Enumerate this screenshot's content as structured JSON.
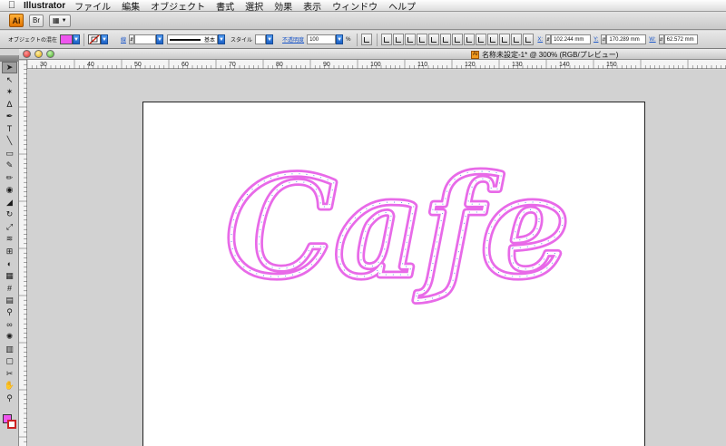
{
  "menubar": {
    "apple": "",
    "app_name": "Illustrator",
    "items": [
      "ファイル",
      "編集",
      "オブジェクト",
      "書式",
      "選択",
      "効果",
      "表示",
      "ウィンドウ",
      "ヘルプ"
    ]
  },
  "appbar": {
    "logo": "Ai",
    "bridge": "Br"
  },
  "control": {
    "label": "オブジェクトの混在",
    "stroke_label": "線",
    "stroke_style": "基本",
    "style_label": "スタイル",
    "opacity_label": "不透明度",
    "opacity_value": "100",
    "opacity_unit": "%",
    "x_label": "X:",
    "x_value": "102.244 mm",
    "y_label": "Y:",
    "y_value": "170.289 mm",
    "w_label": "W:",
    "w_value": "62.572 mm",
    "fill_color": "#ee55ee"
  },
  "document": {
    "title": "名称未設定-1* @ 300% (RGB/プレビュー)",
    "icon": "Ai",
    "artwork_text": "Cafe",
    "ruler_labels": [
      "30",
      "40",
      "50",
      "60",
      "70",
      "80",
      "90",
      "100",
      "110",
      "120",
      "130",
      "140",
      "150"
    ]
  },
  "tools": [
    "selection-tool-icon",
    "direct-selection-tool-icon",
    "magic-wand-tool-icon",
    "lasso-tool-icon",
    "pen-tool-icon",
    "type-tool-icon",
    "line-tool-icon",
    "rectangle-tool-icon",
    "paintbrush-tool-icon",
    "pencil-tool-icon",
    "blob-brush-tool-icon",
    "eraser-tool-icon",
    "rotate-tool-icon",
    "scale-tool-icon",
    "warp-tool-icon",
    "free-transform-tool-icon",
    "shape-builder-tool-icon",
    "perspective-tool-icon",
    "mesh-tool-icon",
    "gradient-tool-icon",
    "eyedropper-tool-icon",
    "blend-tool-icon",
    "symbol-sprayer-tool-icon",
    "column-graph-tool-icon",
    "artboard-tool-icon",
    "slice-tool-icon",
    "hand-tool-icon",
    "zoom-tool-icon"
  ]
}
